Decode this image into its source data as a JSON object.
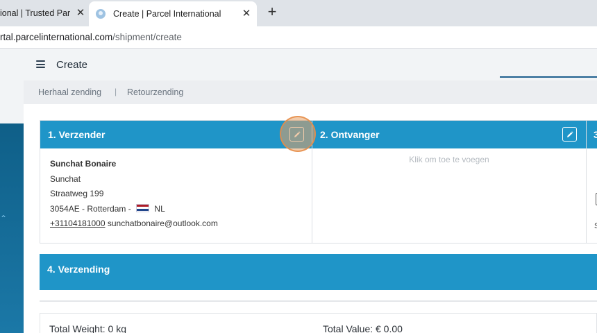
{
  "browser": {
    "tabs": [
      {
        "title": "ional | Trusted Partner",
        "active": false
      },
      {
        "title": "Create | Parcel International",
        "active": true
      }
    ],
    "close_symbol": "✕",
    "new_tab_symbol": "+",
    "url_host": "rtal.parcelinternational.com",
    "url_path": "/shipment/create"
  },
  "header": {
    "title": "Create",
    "menu_icon": "hamburger-menu-icon"
  },
  "breadcrumbs": [
    "Herhaal zending",
    "Retourzending"
  ],
  "breadcrumb_separator": "|",
  "sender": {
    "heading": "1. Verzender",
    "name": "Sunchat Bonaire",
    "company": "Sunchat",
    "street": "Straatweg 199",
    "city_line": "3054AE - Rotterdam -",
    "country": "NL",
    "phone": "+31104181000",
    "email": "sunchatbonaire@outlook.com"
  },
  "receiver": {
    "heading": "2. Ontvanger",
    "placeholder": "Klik om toe te voegen"
  },
  "third": {
    "heading": "3",
    "snippet": "S"
  },
  "shipping": {
    "heading": "4. Verzending"
  },
  "totals": {
    "weight": "Total Weight: 0 kg",
    "value": "Total Value: € 0.00"
  },
  "colors": {
    "primary": "#1f95c8",
    "sidebar": "#0f5f88",
    "highlight": "#e8a064"
  }
}
